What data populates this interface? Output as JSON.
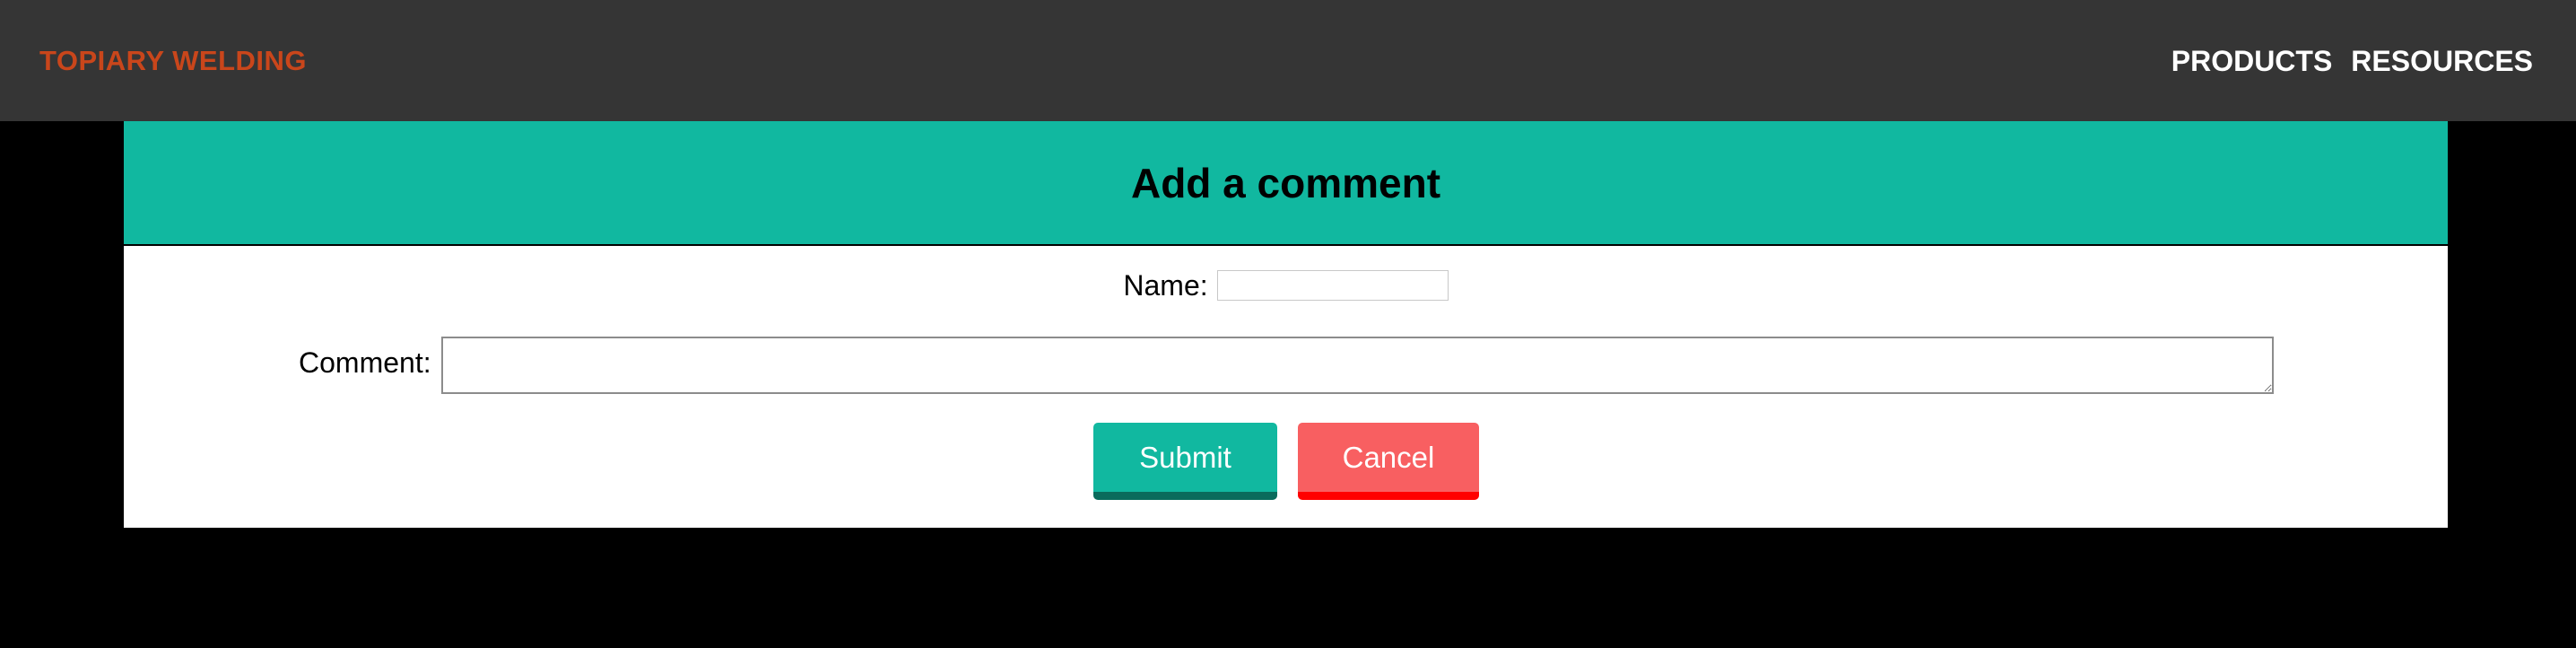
{
  "header": {
    "brand": "TOPIARY WELDING",
    "nav": [
      "PRODUCTS",
      "RESOURCES"
    ]
  },
  "form": {
    "title": "Add a comment",
    "name_label": "Name:",
    "name_value": "",
    "comment_label": "Comment:",
    "comment_value": "",
    "submit_label": "Submit",
    "cancel_label": "Cancel"
  },
  "colors": {
    "topbar": "#353535",
    "brand": "#c9461b",
    "accent": "#11b8a0",
    "accent_dark": "#0a6b5c",
    "cancel": "#f85f61",
    "cancel_dark": "#ff0000",
    "background": "#000000"
  }
}
